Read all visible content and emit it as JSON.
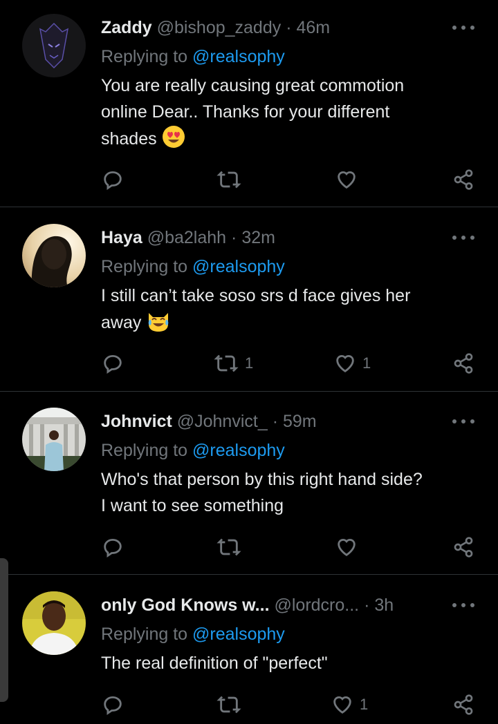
{
  "colors": {
    "background": "#000000",
    "text": "#e7e9ea",
    "secondary": "#71767b",
    "mention": "#1d9bf0",
    "divider": "#2f3336"
  },
  "tweets": [
    {
      "name": "Zaddy",
      "handle": "@bishop_zaddy",
      "dot": "·",
      "time": "46m",
      "replying_prefix": "Replying to ",
      "replying_to": "@realsophy",
      "text_lines": [
        "You are really causing great commotion",
        "online Dear..  Thanks for your different",
        "shades"
      ],
      "emoji": "heart-eyes-emoji",
      "retweets": "",
      "likes": ""
    },
    {
      "name": "Haya",
      "handle": "@ba2lahh",
      "dot": "·",
      "time": "32m",
      "replying_prefix": "Replying to ",
      "replying_to": "@realsophy",
      "text_lines": [
        "I still can’t take soso srs d face gives her",
        "away"
      ],
      "emoji": "tears-of-joy-cat-emoji",
      "retweets": "1",
      "likes": "1"
    },
    {
      "name": "Johnvict",
      "handle": "@Johnvict_",
      "dot": "·",
      "time": "59m",
      "replying_prefix": "Replying to ",
      "replying_to": "@realsophy",
      "text_lines": [
        "Who's that person by this right hand side?",
        "I want to see something"
      ],
      "emoji": "",
      "retweets": "",
      "likes": ""
    },
    {
      "name": "only God Knows w...",
      "handle": "@lordcro...",
      "dot": "·",
      "time": "3h",
      "replying_prefix": "Replying to ",
      "replying_to": "@realsophy",
      "text_lines": [
        "The real definition of \"perfect\""
      ],
      "emoji": "",
      "retweets": "",
      "likes": "1"
    }
  ]
}
